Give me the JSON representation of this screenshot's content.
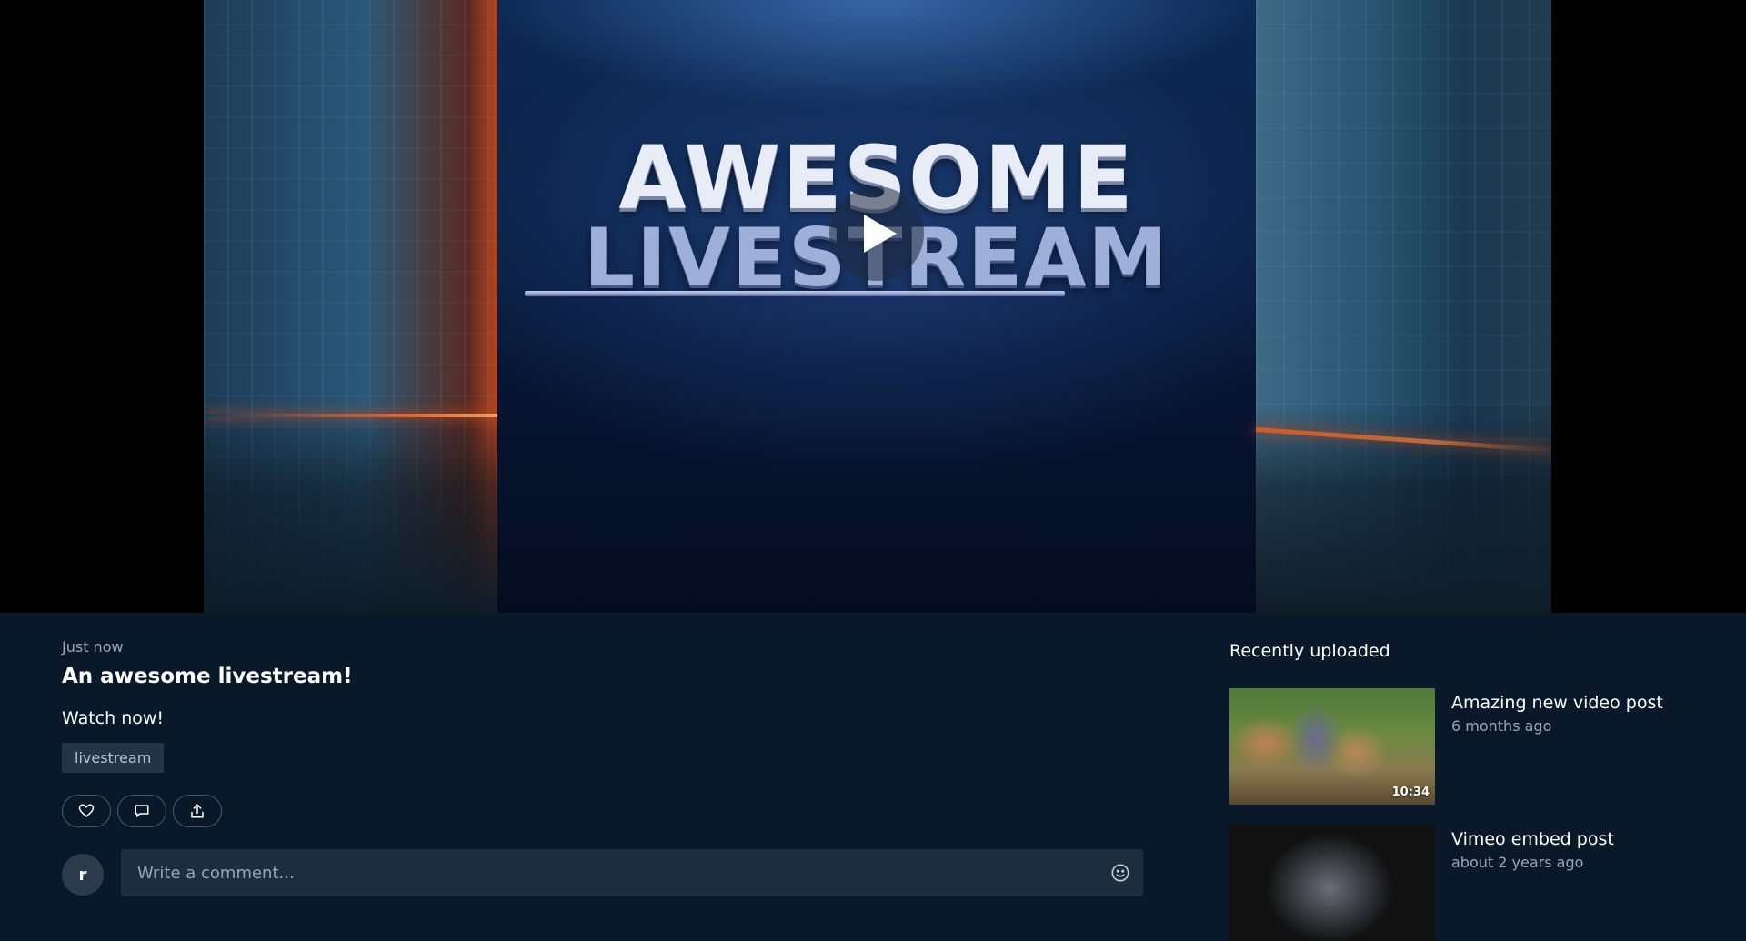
{
  "player": {
    "video_title_line1": "AWESOME",
    "video_title_line2": "LIVESTREAM",
    "play_icon": "play-icon"
  },
  "post": {
    "time": "Just now",
    "title": "An awesome livestream!",
    "description": "Watch now!",
    "tags": [
      "livestream"
    ],
    "actions": {
      "like_icon": "heart-icon",
      "comment_icon": "comment-icon",
      "share_icon": "share-icon"
    }
  },
  "comment": {
    "avatar_initial": "r",
    "placeholder": "Write a comment...",
    "emoji_icon": "smiley-icon"
  },
  "sidebar": {
    "heading": "Recently uploaded",
    "videos": [
      {
        "title": "Amazing new video post",
        "time": "6 months ago",
        "duration": "10:34"
      },
      {
        "title": "Vimeo embed post",
        "time": "about 2 years ago",
        "duration": ""
      }
    ]
  },
  "colors": {
    "background": "#0a192a",
    "input_background": "#1e2d3d",
    "tag_background": "#233447",
    "muted_text": "#9aa6b5"
  }
}
